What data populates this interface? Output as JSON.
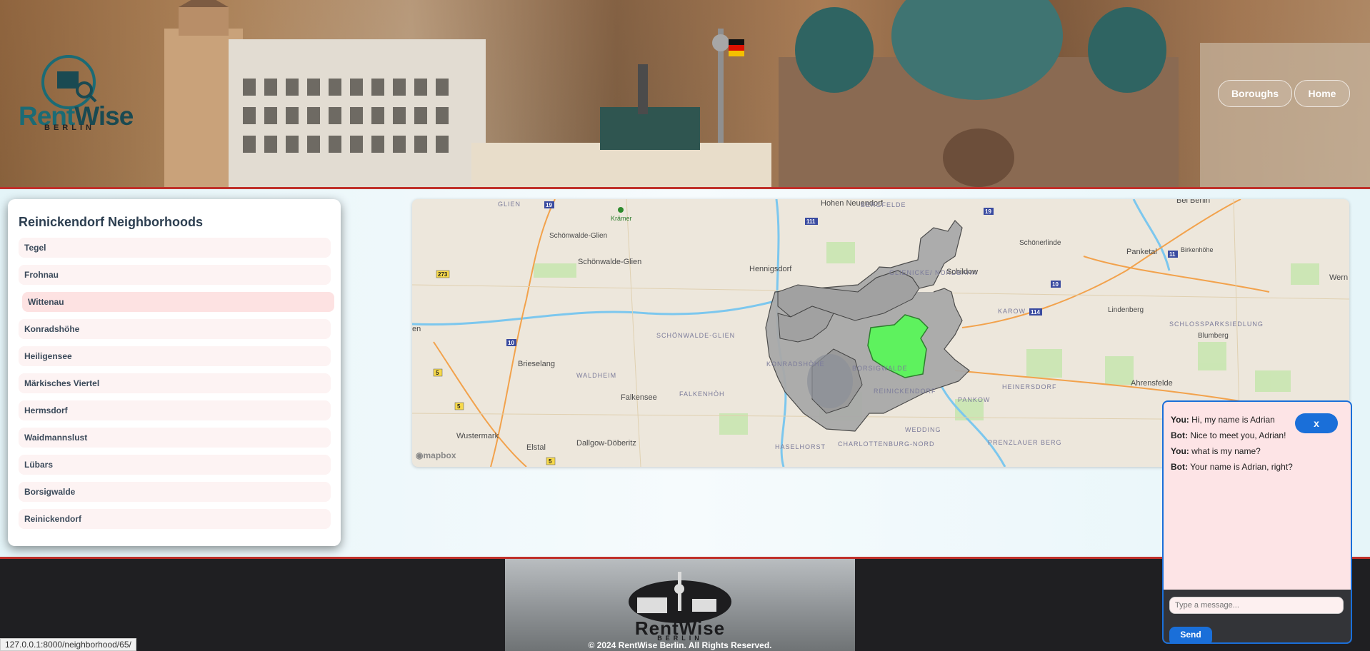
{
  "header": {
    "logo_text_a": "Rent",
    "logo_text_b": "Wise",
    "logo_sub": "BERLIN",
    "nav": {
      "boroughs": "Boroughs",
      "home": "Home"
    }
  },
  "sidebar": {
    "title": "Reinickendorf Neighborhoods",
    "items": [
      {
        "label": "Tegel"
      },
      {
        "label": "Frohnau"
      },
      {
        "label": "Wittenau"
      },
      {
        "label": "Konradshöhe"
      },
      {
        "label": "Heiligensee"
      },
      {
        "label": "Märkisches Viertel"
      },
      {
        "label": "Hermsdorf"
      },
      {
        "label": "Waidmannslust"
      },
      {
        "label": "Lübars"
      },
      {
        "label": "Borsigwalde"
      },
      {
        "label": "Reinickendorf"
      }
    ],
    "active_index": 2
  },
  "map": {
    "attribution": "mapbox",
    "labels": [
      "Hohen Neuendorf",
      "BERGFELDE",
      "Bei Berlin",
      "Krämer",
      "Schönwalde-Glien",
      "Schönwalde-Glien",
      "Hennigsdorf",
      "GLIENICKE/ NORDBAHN",
      "Schildow",
      "Schönerlinde",
      "Panketal",
      "Birkenhöhe",
      "Wern",
      "KAROW",
      "Lindenberg",
      "SCHLOSSPARKSIEDLUNG",
      "Blumberg",
      "SCHÖNWALDE-GLIEN",
      "Brieselang",
      "WALDHEIM",
      "Falkensee",
      "FALKENHÖH",
      "KONRADSHÖHE",
      "BORSIGWALDE",
      "REINICKENDORF",
      "HEINERSDORF",
      "PANKOW",
      "Ahrensfelde",
      "Wustermark",
      "Elstal",
      "Dallgow-Döberitz",
      "HASELHORST",
      "CHARLOTTENBURG-NORD",
      "WEDDING",
      "PRENZLAUER BERG",
      "GLIEN",
      "en"
    ],
    "road_shields": [
      "19",
      "111",
      "273",
      "10",
      "5",
      "5",
      "5",
      "19",
      "114",
      "10",
      "11"
    ],
    "highlight_color": "#5ef25e",
    "borough_color": "#a9a9a9"
  },
  "chat": {
    "messages": [
      {
        "who": "You:",
        "text": "Hi, my name is Adrian"
      },
      {
        "who": "Bot:",
        "text": "Nice to meet you, Adrian!"
      },
      {
        "who": "You:",
        "text": "what is my name?"
      },
      {
        "who": "Bot:",
        "text": "Your name is Adrian, right?"
      }
    ],
    "close_label": "x",
    "input_placeholder": "Type a message...",
    "send_label": "Send"
  },
  "footer": {
    "logo_text": "RentWise",
    "logo_sub": "BERLIN",
    "copyright": "© 2024 RentWise Berlin. All Rights Reserved."
  },
  "status_url": "127.0.0.1:8000/neighborhood/65/"
}
